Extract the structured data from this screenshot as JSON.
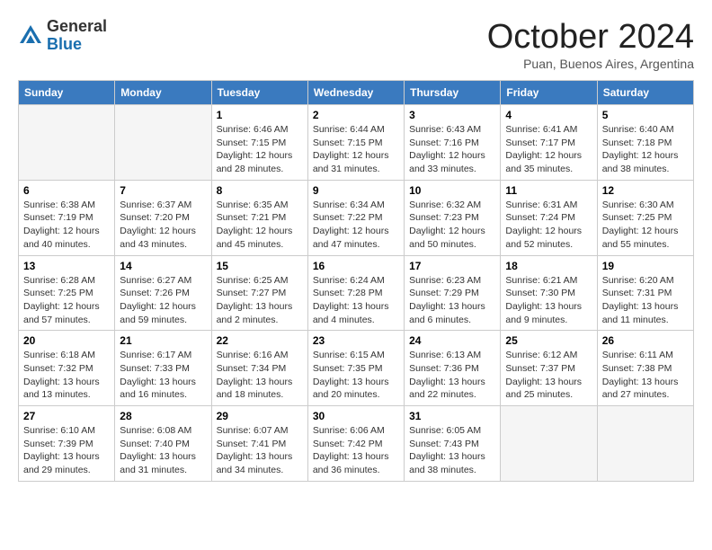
{
  "header": {
    "logo_general": "General",
    "logo_blue": "Blue",
    "month_title": "October 2024",
    "location": "Puan, Buenos Aires, Argentina"
  },
  "weekdays": [
    "Sunday",
    "Monday",
    "Tuesday",
    "Wednesday",
    "Thursday",
    "Friday",
    "Saturday"
  ],
  "weeks": [
    [
      {
        "day": "",
        "info": ""
      },
      {
        "day": "",
        "info": ""
      },
      {
        "day": "1",
        "info": "Sunrise: 6:46 AM\nSunset: 7:15 PM\nDaylight: 12 hours and 28 minutes."
      },
      {
        "day": "2",
        "info": "Sunrise: 6:44 AM\nSunset: 7:15 PM\nDaylight: 12 hours and 31 minutes."
      },
      {
        "day": "3",
        "info": "Sunrise: 6:43 AM\nSunset: 7:16 PM\nDaylight: 12 hours and 33 minutes."
      },
      {
        "day": "4",
        "info": "Sunrise: 6:41 AM\nSunset: 7:17 PM\nDaylight: 12 hours and 35 minutes."
      },
      {
        "day": "5",
        "info": "Sunrise: 6:40 AM\nSunset: 7:18 PM\nDaylight: 12 hours and 38 minutes."
      }
    ],
    [
      {
        "day": "6",
        "info": "Sunrise: 6:38 AM\nSunset: 7:19 PM\nDaylight: 12 hours and 40 minutes."
      },
      {
        "day": "7",
        "info": "Sunrise: 6:37 AM\nSunset: 7:20 PM\nDaylight: 12 hours and 43 minutes."
      },
      {
        "day": "8",
        "info": "Sunrise: 6:35 AM\nSunset: 7:21 PM\nDaylight: 12 hours and 45 minutes."
      },
      {
        "day": "9",
        "info": "Sunrise: 6:34 AM\nSunset: 7:22 PM\nDaylight: 12 hours and 47 minutes."
      },
      {
        "day": "10",
        "info": "Sunrise: 6:32 AM\nSunset: 7:23 PM\nDaylight: 12 hours and 50 minutes."
      },
      {
        "day": "11",
        "info": "Sunrise: 6:31 AM\nSunset: 7:24 PM\nDaylight: 12 hours and 52 minutes."
      },
      {
        "day": "12",
        "info": "Sunrise: 6:30 AM\nSunset: 7:25 PM\nDaylight: 12 hours and 55 minutes."
      }
    ],
    [
      {
        "day": "13",
        "info": "Sunrise: 6:28 AM\nSunset: 7:25 PM\nDaylight: 12 hours and 57 minutes."
      },
      {
        "day": "14",
        "info": "Sunrise: 6:27 AM\nSunset: 7:26 PM\nDaylight: 12 hours and 59 minutes."
      },
      {
        "day": "15",
        "info": "Sunrise: 6:25 AM\nSunset: 7:27 PM\nDaylight: 13 hours and 2 minutes."
      },
      {
        "day": "16",
        "info": "Sunrise: 6:24 AM\nSunset: 7:28 PM\nDaylight: 13 hours and 4 minutes."
      },
      {
        "day": "17",
        "info": "Sunrise: 6:23 AM\nSunset: 7:29 PM\nDaylight: 13 hours and 6 minutes."
      },
      {
        "day": "18",
        "info": "Sunrise: 6:21 AM\nSunset: 7:30 PM\nDaylight: 13 hours and 9 minutes."
      },
      {
        "day": "19",
        "info": "Sunrise: 6:20 AM\nSunset: 7:31 PM\nDaylight: 13 hours and 11 minutes."
      }
    ],
    [
      {
        "day": "20",
        "info": "Sunrise: 6:18 AM\nSunset: 7:32 PM\nDaylight: 13 hours and 13 minutes."
      },
      {
        "day": "21",
        "info": "Sunrise: 6:17 AM\nSunset: 7:33 PM\nDaylight: 13 hours and 16 minutes."
      },
      {
        "day": "22",
        "info": "Sunrise: 6:16 AM\nSunset: 7:34 PM\nDaylight: 13 hours and 18 minutes."
      },
      {
        "day": "23",
        "info": "Sunrise: 6:15 AM\nSunset: 7:35 PM\nDaylight: 13 hours and 20 minutes."
      },
      {
        "day": "24",
        "info": "Sunrise: 6:13 AM\nSunset: 7:36 PM\nDaylight: 13 hours and 22 minutes."
      },
      {
        "day": "25",
        "info": "Sunrise: 6:12 AM\nSunset: 7:37 PM\nDaylight: 13 hours and 25 minutes."
      },
      {
        "day": "26",
        "info": "Sunrise: 6:11 AM\nSunset: 7:38 PM\nDaylight: 13 hours and 27 minutes."
      }
    ],
    [
      {
        "day": "27",
        "info": "Sunrise: 6:10 AM\nSunset: 7:39 PM\nDaylight: 13 hours and 29 minutes."
      },
      {
        "day": "28",
        "info": "Sunrise: 6:08 AM\nSunset: 7:40 PM\nDaylight: 13 hours and 31 minutes."
      },
      {
        "day": "29",
        "info": "Sunrise: 6:07 AM\nSunset: 7:41 PM\nDaylight: 13 hours and 34 minutes."
      },
      {
        "day": "30",
        "info": "Sunrise: 6:06 AM\nSunset: 7:42 PM\nDaylight: 13 hours and 36 minutes."
      },
      {
        "day": "31",
        "info": "Sunrise: 6:05 AM\nSunset: 7:43 PM\nDaylight: 13 hours and 38 minutes."
      },
      {
        "day": "",
        "info": ""
      },
      {
        "day": "",
        "info": ""
      }
    ]
  ]
}
